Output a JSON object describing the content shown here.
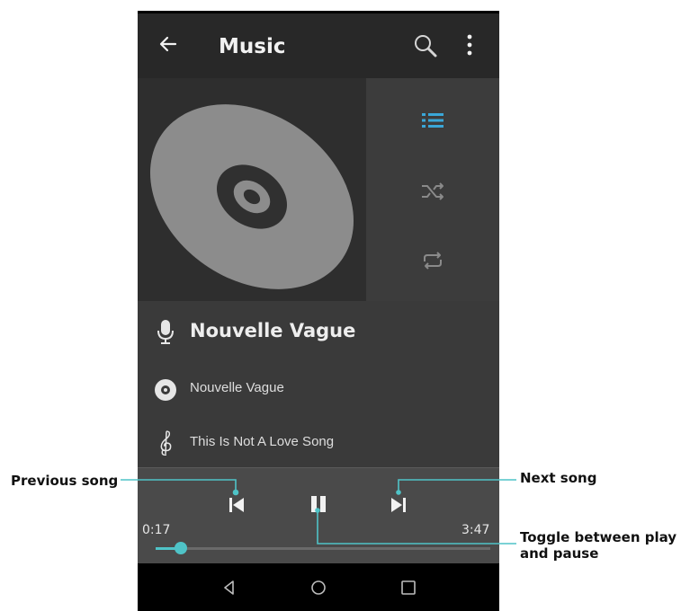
{
  "app": {
    "title": "Music"
  },
  "appbar_icons": [
    "back-arrow-icon",
    "search-icon",
    "more-vert-icon"
  ],
  "side_icons": [
    "playlist-icon",
    "shuffle-icon",
    "repeat-icon"
  ],
  "now_playing": {
    "artist": "Nouvelle Vague",
    "album": "Nouvelle Vague",
    "song": "This Is Not A Love Song"
  },
  "playback": {
    "elapsed": "0:17",
    "duration": "3:47",
    "progress_fraction": 0.075
  },
  "callouts": {
    "previous": "Previous song",
    "next": "Next song",
    "toggle": "Toggle between play and pause"
  },
  "colors": {
    "accent": "#4fc3c7",
    "highlight": "#3aa7d8"
  }
}
